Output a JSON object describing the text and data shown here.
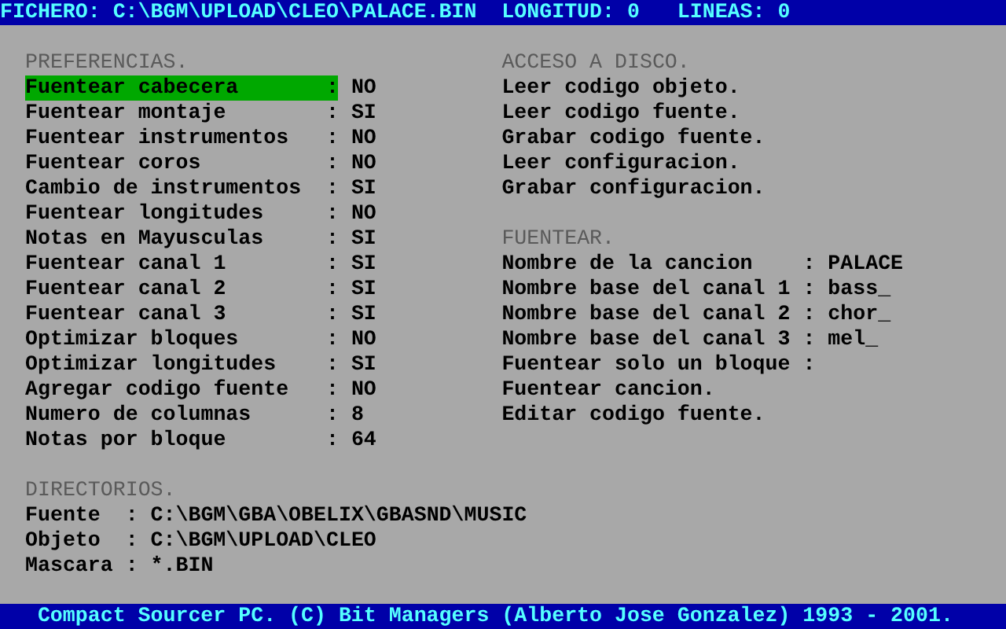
{
  "status_bar": {
    "fields": [
      {
        "label": "FICHERO:",
        "value": "C:\\BGM\\UPLOAD\\CLEO\\PALACE.BIN"
      },
      {
        "label": "LONGITUD:",
        "value": "0"
      },
      {
        "label": "LINEAS:",
        "value": "0"
      }
    ]
  },
  "separator": ":",
  "preferences": {
    "title": "PREFERENCIAS.",
    "items": [
      {
        "label": "Fuentear cabecera",
        "value": "NO",
        "selected": true
      },
      {
        "label": "Fuentear montaje",
        "value": "SI",
        "selected": false
      },
      {
        "label": "Fuentear instrumentos",
        "value": "NO",
        "selected": false
      },
      {
        "label": "Fuentear coros",
        "value": "NO",
        "selected": false
      },
      {
        "label": "Cambio de instrumentos",
        "value": "SI",
        "selected": false
      },
      {
        "label": "Fuentear longitudes",
        "value": "NO",
        "selected": false
      },
      {
        "label": "Notas en Mayusculas",
        "value": "SI",
        "selected": false
      },
      {
        "label": "Fuentear canal 1",
        "value": "SI",
        "selected": false
      },
      {
        "label": "Fuentear canal 2",
        "value": "SI",
        "selected": false
      },
      {
        "label": "Fuentear canal 3",
        "value": "SI",
        "selected": false
      },
      {
        "label": "Optimizar bloques",
        "value": "NO",
        "selected": false
      },
      {
        "label": "Optimizar longitudes",
        "value": "SI",
        "selected": false
      },
      {
        "label": "Agregar codigo fuente",
        "value": "NO",
        "selected": false
      },
      {
        "label": "Numero de columnas",
        "value": "8",
        "selected": false
      },
      {
        "label": "Notas por bloque",
        "value": "64",
        "selected": false
      }
    ]
  },
  "disk": {
    "title": "ACCESO A DISCO.",
    "items": [
      {
        "kind": "action",
        "label": "Leer codigo objeto."
      },
      {
        "kind": "action",
        "label": "Leer codigo fuente."
      },
      {
        "kind": "action",
        "label": "Grabar codigo fuente."
      },
      {
        "kind": "action",
        "label": "Leer configuracion."
      },
      {
        "kind": "action",
        "label": "Grabar configuracion."
      }
    ]
  },
  "fuentear": {
    "title": "FUENTEAR.",
    "items": [
      {
        "kind": "field",
        "label": "Nombre de la cancion",
        "value": "PALACE"
      },
      {
        "kind": "field",
        "label": "Nombre base del canal 1",
        "value": "bass_"
      },
      {
        "kind": "field",
        "label": "Nombre base del canal 2",
        "value": "chor_"
      },
      {
        "kind": "field",
        "label": "Nombre base del canal 3",
        "value": "mel_"
      },
      {
        "kind": "field",
        "label": "Fuentear solo un bloque"
      },
      {
        "kind": "action",
        "label": "Fuentear cancion."
      },
      {
        "kind": "action",
        "label": "Editar codigo fuente."
      }
    ]
  },
  "directories": {
    "title": "DIRECTORIOS.",
    "items": [
      {
        "label": "Fuente",
        "value": "C:\\BGM\\GBA\\OBELIX\\GBASND\\MUSIC"
      },
      {
        "label": "Objeto",
        "value": "C:\\BGM\\UPLOAD\\CLEO"
      },
      {
        "label": "Mascara",
        "value": "*.BIN"
      }
    ]
  },
  "footer": "Compact Sourcer PC. (C) Bit Managers (Alberto Jose Gonzalez) 1993 - 2001."
}
